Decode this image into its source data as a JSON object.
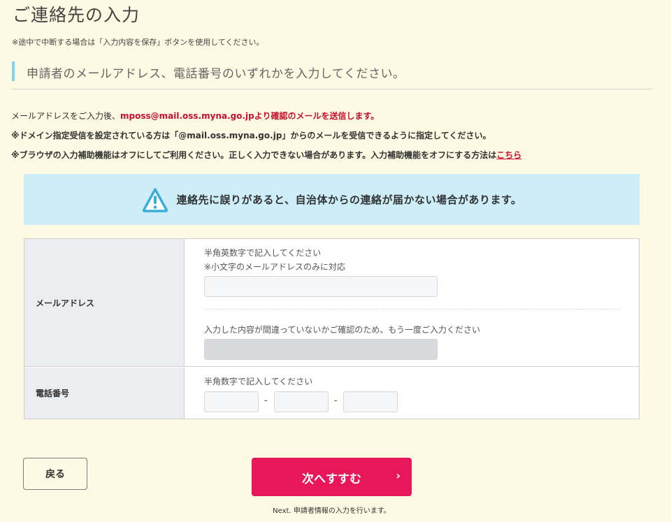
{
  "page": {
    "title": "ご連絡先の入力",
    "intro_note": "※途中で中断する場合は「入力内容を保存」ボタンを使用してください。"
  },
  "section": {
    "heading": "申請者のメールアドレス、電話番号のいずれかを入力してください。"
  },
  "notes": {
    "line1_prefix": "メールアドレスをご入力後、",
    "line1_emphasis": "mposs@mail.oss.myna.go.jpより確認のメールを送信します。",
    "line2": "※ドメイン指定受信を設定されている方は「@mail.oss.myna.go.jp」からのメールを受信できるように指定してください。",
    "line3_prefix": "※ブラウザの入力補助機能はオフにしてご利用ください。正しく入力できない場合があります。入力補助機能をオフにする方法は",
    "line3_link": "こちら"
  },
  "alert": {
    "icon": "warning-triangle-icon",
    "text": "連絡先に誤りがあると、自治体からの連絡が届かない場合があります。"
  },
  "form": {
    "email": {
      "label": "メールアドレス",
      "hint1": "半角英数字で記入してください",
      "hint2": "※小文字のメールアドレスのみに対応",
      "value": "",
      "confirm_hint": "入力した内容が間違っていないかご確認のため、もう一度ご入力ください",
      "confirm_value": ""
    },
    "phone": {
      "label": "電話番号",
      "hint": "半角数字で記入してください",
      "separator": "-",
      "part1": "",
      "part2": "",
      "part3": ""
    }
  },
  "buttons": {
    "back": "戻る",
    "next": "次へすすむ",
    "next_chevron": "›",
    "next_caption": "Next. 申請者情報の入力を行います。"
  },
  "colors": {
    "background": "#fef9e3",
    "accent": "#e8165a",
    "alert_bg": "#cdeef8",
    "emphasis_red": "#c8102e",
    "heading_bar": "#82d3ee"
  }
}
